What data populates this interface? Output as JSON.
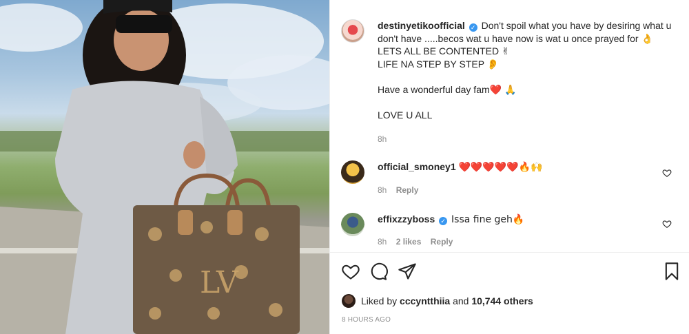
{
  "post": {
    "username": "destinyetikoofficial",
    "caption_lines": [
      "Don't spoil what you have by desiring what u don't have .....becos wat u have now is wat u once prayed for 👌",
      "LETS ALL BE CONTENTED ✌",
      "LIFE NA STEP BY STEP 👂",
      "",
      "Have a wonderful day fam❤️ 🙏",
      "",
      "LOVE U ALL"
    ],
    "caption_time": "8h"
  },
  "comments": [
    {
      "username": "official_smoney1",
      "verified": false,
      "text": "❤️❤️❤️❤️❤️🔥🙌",
      "time": "8h",
      "likes": "",
      "reply_label": "Reply"
    },
    {
      "username": "effixzzyboss",
      "verified": true,
      "text": "Issa fine geh🔥",
      "time": "8h",
      "likes": "2 likes",
      "reply_label": "Reply"
    }
  ],
  "actions": {
    "like_icon": "heart-outline-icon",
    "comment_icon": "comment-bubble-icon",
    "share_icon": "paper-plane-icon",
    "save_icon": "bookmark-icon"
  },
  "likes": {
    "prefix": "Liked by",
    "first_user": "cccyntthiia",
    "joiner": "and",
    "count": "10,744 others"
  },
  "time_ago": "8 HOURS AGO",
  "colors": {
    "text": "#262626",
    "muted": "#8e8e8e",
    "verified": "#3897f0",
    "divider": "#efefef"
  }
}
